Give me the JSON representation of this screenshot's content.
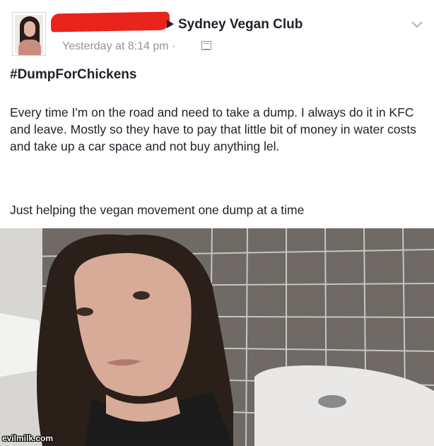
{
  "post": {
    "group_name": "Sydney Vegan Club",
    "timestamp": "Yesterday at 8:14 pm ·",
    "hashtag": "#DumpForChickens",
    "paragraphs": [
      "Every time I'm on the road and need to take a dump. I always do it in KFC and leave. Mostly so they have to pay that little bit of money in water costs and take up a car space and not buy anything lel.",
      "Just helping the vegan movement one dump at a time"
    ],
    "icons": {
      "audience": "globe-icon",
      "menu": "chevron-down-icon",
      "redaction": "red-scribble-redaction"
    }
  },
  "watermark": "evilmilk.com",
  "colors": {
    "text": "#1d2129",
    "meta": "#90949c",
    "redaction": "#e8241c",
    "tile": "#6f6a66",
    "grout": "#c9c6c2"
  }
}
